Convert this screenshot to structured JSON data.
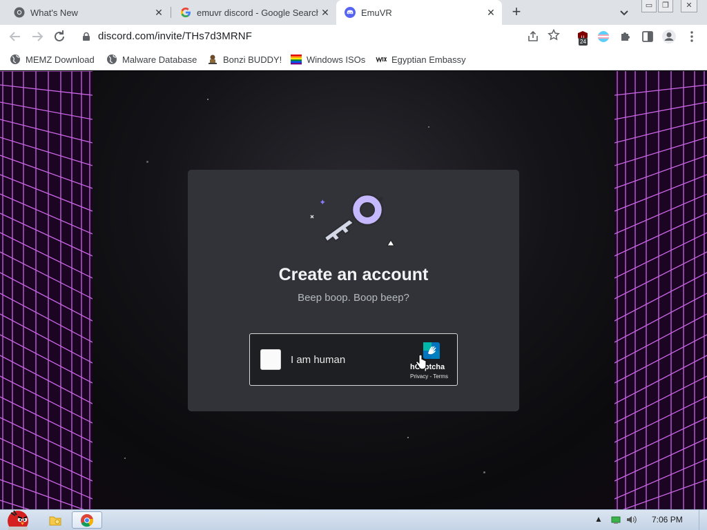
{
  "tabs": [
    {
      "title": "What's New",
      "active": false,
      "favicon": "chrome-icon"
    },
    {
      "title": "emuvr discord - Google Search",
      "active": false,
      "favicon": "google-icon"
    },
    {
      "title": "EmuVR",
      "active": true,
      "favicon": "discord-icon"
    }
  ],
  "tab_close_glyph": "✕",
  "new_tab_glyph": "+",
  "window_controls": {
    "minimize": "▭",
    "restore": "❐",
    "close": "✕"
  },
  "toolbar": {
    "url": "discord.com/invite/THs7d3MRNF",
    "extension_badge": "24"
  },
  "bookmarks": [
    {
      "label": "MEMZ Download",
      "icon": "globe-icon"
    },
    {
      "label": "Malware Database",
      "icon": "globe-icon"
    },
    {
      "label": "Bonzi BUDDY!",
      "icon": "bonzi-icon"
    },
    {
      "label": "Windows ISOs",
      "icon": "rainbow-flag-icon"
    },
    {
      "label": "Egyptian Embassy",
      "icon": "wix-icon"
    }
  ],
  "card": {
    "title": "Create an account",
    "subtitle": "Beep boop. Boop beep?",
    "captcha": {
      "label": "I am human",
      "brand": "hCaptcha",
      "links": "Privacy - Terms"
    }
  },
  "taskbar": {
    "clock": "7:06 PM"
  },
  "colors": {
    "card_bg": "#313338",
    "accent_purple": "#c5b8ff",
    "grid_magenta": "#e040fb"
  }
}
